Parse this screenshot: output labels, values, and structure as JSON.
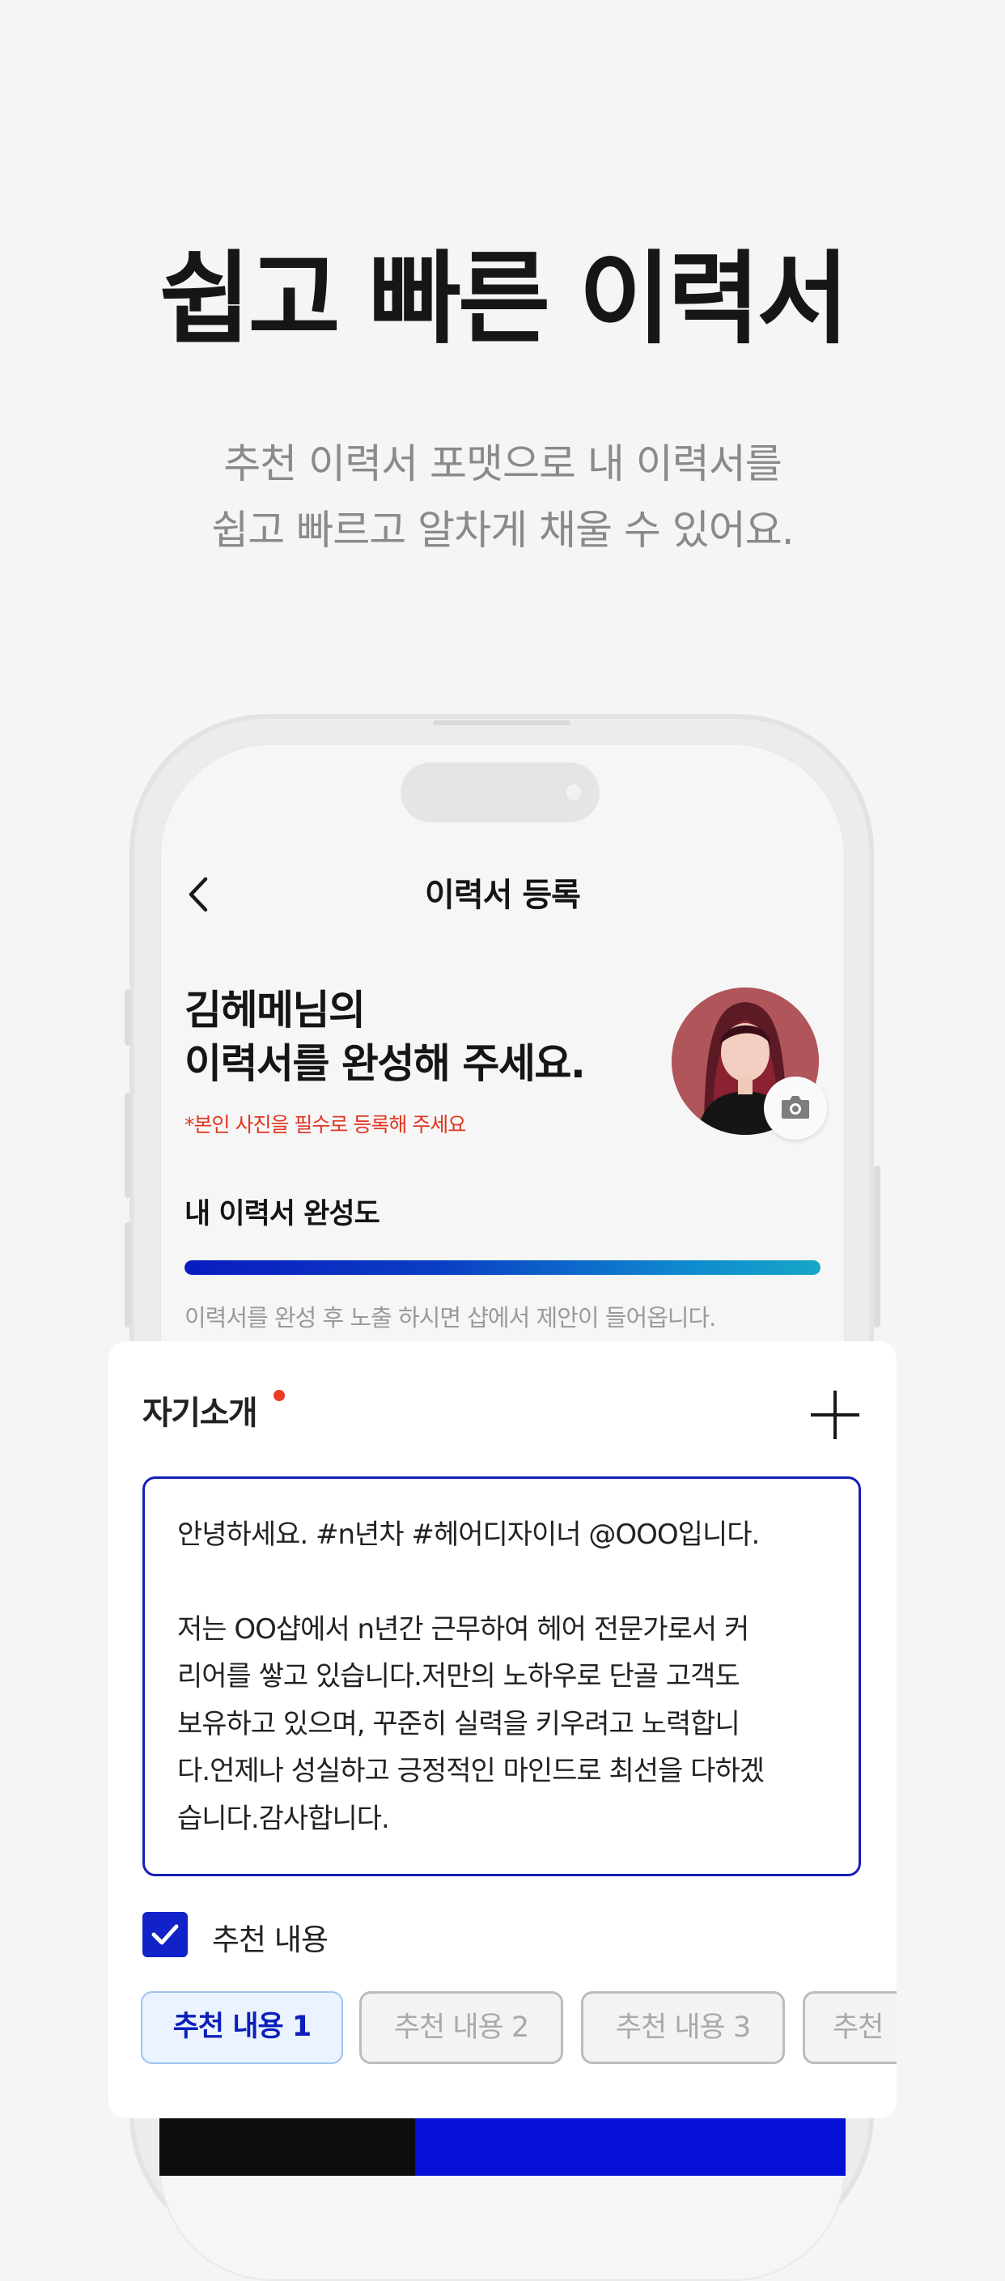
{
  "hero": {
    "title": "쉽고 빠른 이력서",
    "subtitle_line1": "추천 이력서 포맷으로 내 이력서를",
    "subtitle_line2": "쉽고 빠르고 알차게 채울 수 있어요."
  },
  "screen": {
    "title": "이력서 등록",
    "greeting_line1": "김헤메님의",
    "greeting_line2": "이력서를 완성해 주세요.",
    "photo_warning": "*본인 사진을 필수로 등록해 주세요",
    "progress_title": "내 이력서 완성도",
    "progress_value": 1.0,
    "progress_note": "이력서를 완성 후 노출 하시면 샵에서 제안이 들어옵니다."
  },
  "card": {
    "title": "자기소개",
    "intro_line": "안녕하세요. #n년차 #헤어디자이너 @OOO입니다.",
    "body_lines": [
      "저는 OO샵에서 n년간 근무하여 헤어 전문가로서 커",
      "리어를 쌓고 있습니다.저만의 노하우로 단골 고객도",
      "보유하고 있으며, 꾸준히 실력을 키우려고 노력합니",
      "다.언제나 성실하고 긍정적인 마인드로 최선을 다하겠",
      "습니다.감사합니다."
    ],
    "checkbox_label": "추천 내용",
    "checkbox_checked": true,
    "chips": [
      "추천 내용 1",
      "추천 내용 2",
      "추천 내용 3",
      "추천"
    ]
  },
  "icons": {
    "back": "chevron-left-icon",
    "camera": "camera-icon",
    "plus": "plus-icon",
    "check": "check-icon"
  },
  "colors": {
    "accent": "#1122c9",
    "warning": "#e0351f",
    "required_dot": "#ee3a24",
    "chip_active_text": "#0c1fba"
  }
}
